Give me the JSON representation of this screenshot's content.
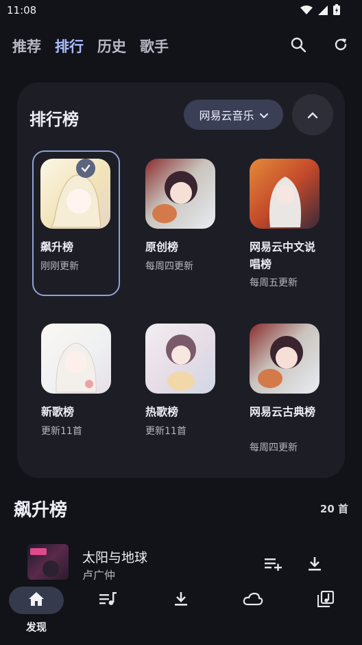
{
  "status": {
    "time": "11:08"
  },
  "topnav": {
    "tabs": [
      "推荐",
      "排行",
      "历史",
      "歌手"
    ],
    "active_index": 1
  },
  "chart_section": {
    "title": "排行榜",
    "source_select": "网易云音乐",
    "items": [
      {
        "name": "飙升榜",
        "sub": "刚刚更新",
        "selected": true
      },
      {
        "name": "原创榜",
        "sub": "每周四更新"
      },
      {
        "name": "网易云中文说唱榜",
        "sub": "每周五更新"
      },
      {
        "name": "新歌榜",
        "sub": "更新11首"
      },
      {
        "name": "热歌榜",
        "sub": "更新11首"
      },
      {
        "name": "网易云古典榜",
        "sub": "每周四更新"
      }
    ]
  },
  "list_section": {
    "title": "飙升榜",
    "count": "20 首"
  },
  "songs": [
    {
      "title": "太阳与地球",
      "artist": "卢广仲"
    }
  ],
  "bottomnav": {
    "active_label": "发现"
  },
  "colors": {
    "accent": "#a9bffd",
    "background": "#121219",
    "card": "#1d1e25"
  }
}
